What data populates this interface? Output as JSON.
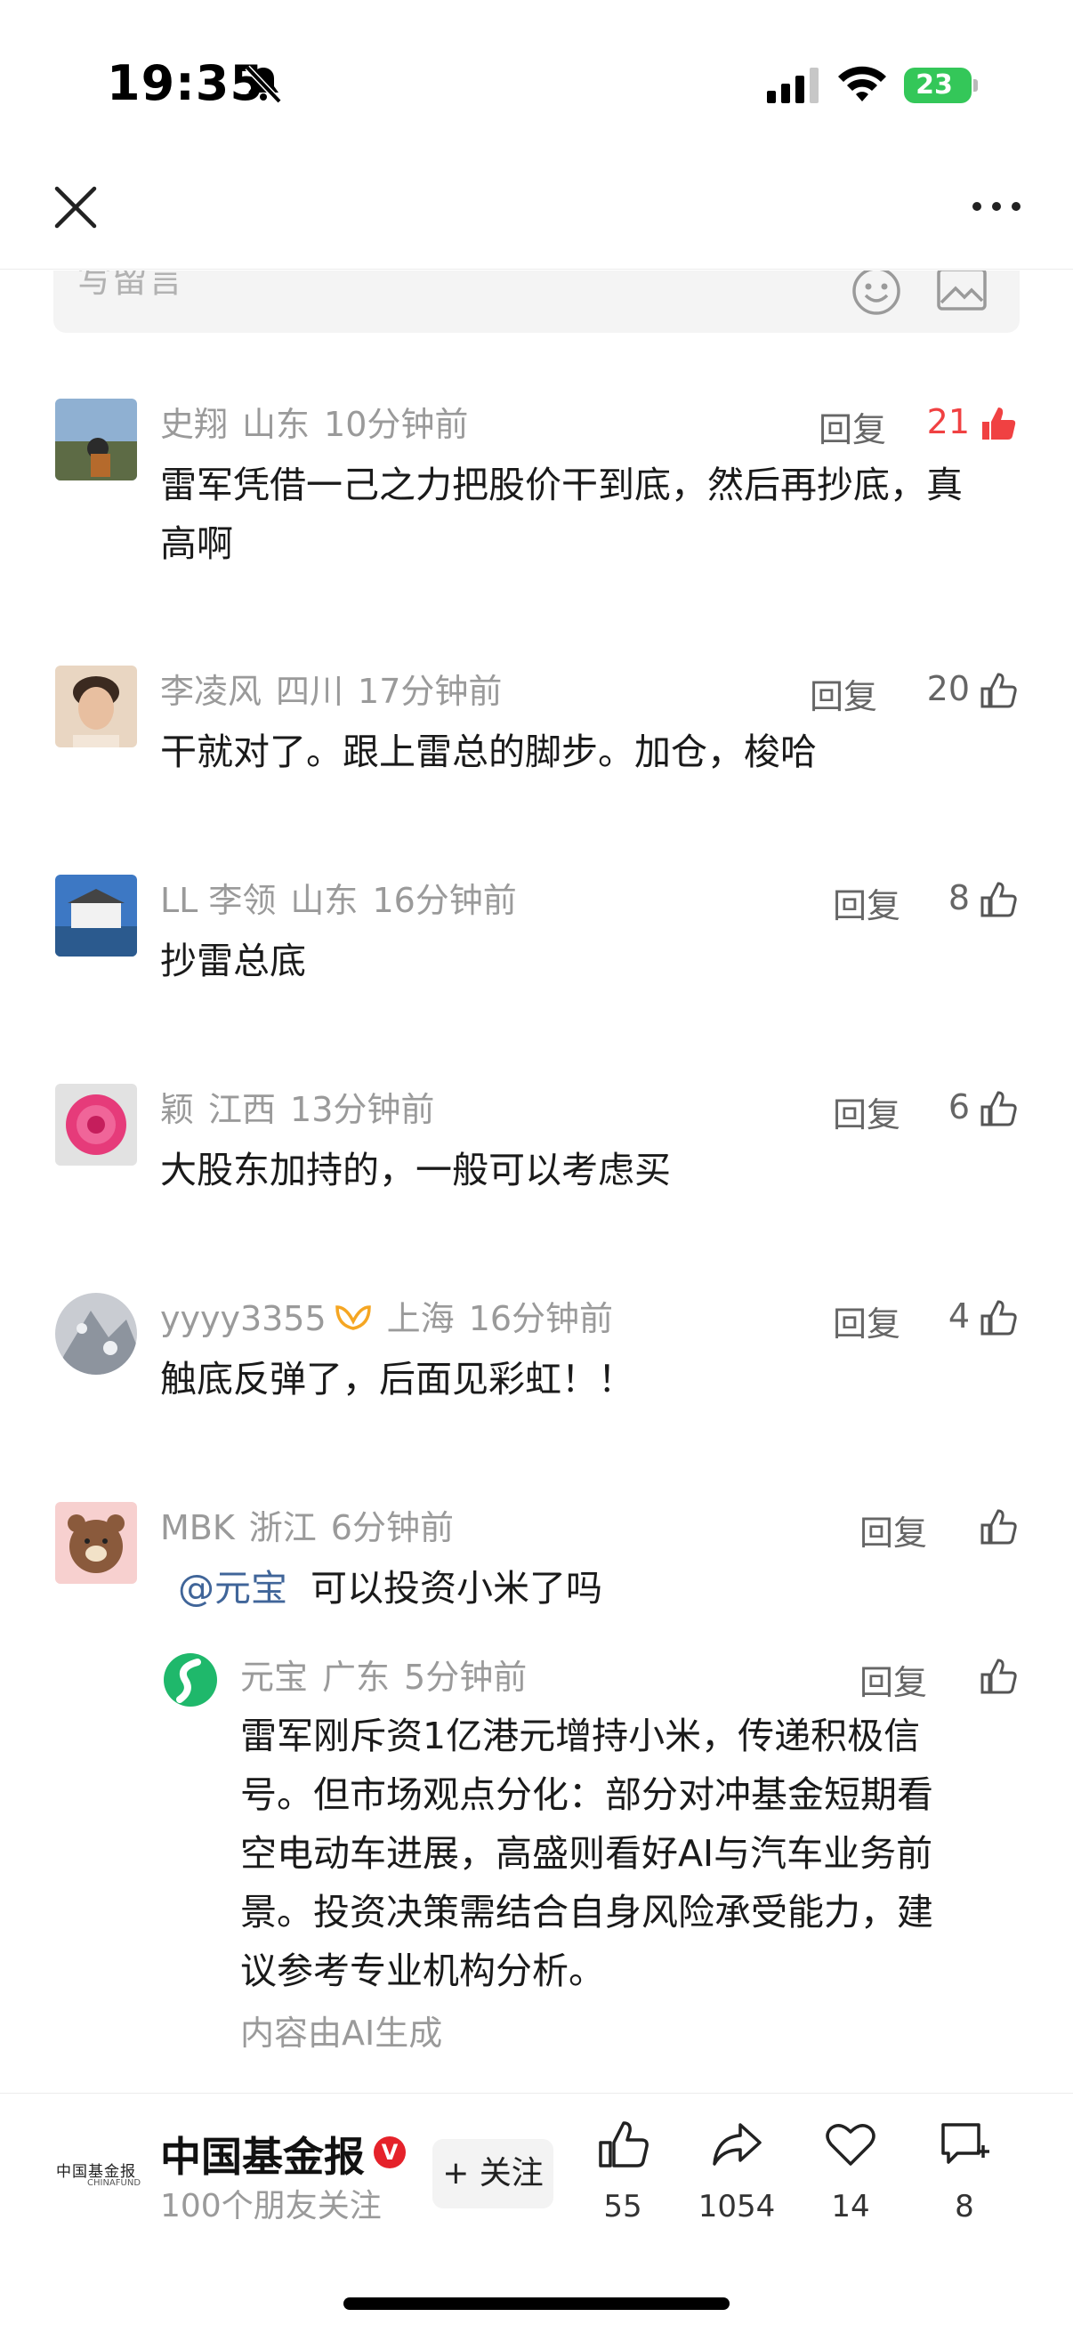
{
  "status_bar": {
    "time": "19:35",
    "battery": "23"
  },
  "input": {
    "placeholder": "写留言"
  },
  "comments": [
    {
      "name": "史翔",
      "location": "山东",
      "time": "10分钟前",
      "reply_label": "回复",
      "likes": "21",
      "text": "雷军凭借一己之力把股价干到底，然后再抄底，真高啊"
    },
    {
      "name": "李凌风",
      "location": "四川",
      "time": "17分钟前",
      "reply_label": "回复",
      "likes": "20",
      "text": "干就对了。跟上雷总的脚步。加仓，梭哈"
    },
    {
      "name": "LL 李领",
      "location": "山东",
      "time": "16分钟前",
      "reply_label": "回复",
      "likes": "8",
      "text": "抄雷总底"
    },
    {
      "name": "颖",
      "location": "江西",
      "time": "13分钟前",
      "reply_label": "回复",
      "likes": "6",
      "text": "大股东加持的，一般可以考虑买"
    },
    {
      "name": "yyyy3355",
      "location": "上海",
      "time": "16分钟前",
      "reply_label": "回复",
      "likes": "4",
      "text": "触底反弹了，后面见彩虹！！"
    },
    {
      "name": "MBK",
      "location": "浙江",
      "time": "6分钟前",
      "reply_label": "回复",
      "likes": "",
      "mention": "@元宝",
      "text": "可以投资小米了吗"
    }
  ],
  "ai_reply": {
    "name": "元宝",
    "location": "广东",
    "time": "5分钟前",
    "reply_label": "回复",
    "lines": [
      "雷军刚斥资1亿港元增持小米，传递积极信",
      "号。但市场观点分化：部分对冲基金短期看",
      "空电动车进展，高盛则看好AI与汽车业务前",
      "景。投资决策需结合自身风险承受能力，建",
      "议参考专业机构分析。"
    ],
    "note": "内容由AI生成"
  },
  "bottom_bar": {
    "publisher_logo_cn": "中国基金报",
    "publisher_logo_en": "CHINAFUND",
    "publisher_name": "中国基金报",
    "verify_mark": "V",
    "followers": "100个朋友关注",
    "follow_label": "+ 关注",
    "like_count": "55",
    "share_count": "1054",
    "favorite_count": "14",
    "comment_count": "8"
  },
  "colors": {
    "accent_red": "#f04142",
    "mention_blue": "#406599",
    "battery_green": "#34c759"
  },
  "icons": [
    "bell-slash-icon",
    "signal-icon",
    "wifi-icon",
    "close-icon",
    "more-icon",
    "emoji-icon",
    "image-icon",
    "thumb-up-icon",
    "share-icon",
    "heart-icon",
    "comment-icon"
  ]
}
